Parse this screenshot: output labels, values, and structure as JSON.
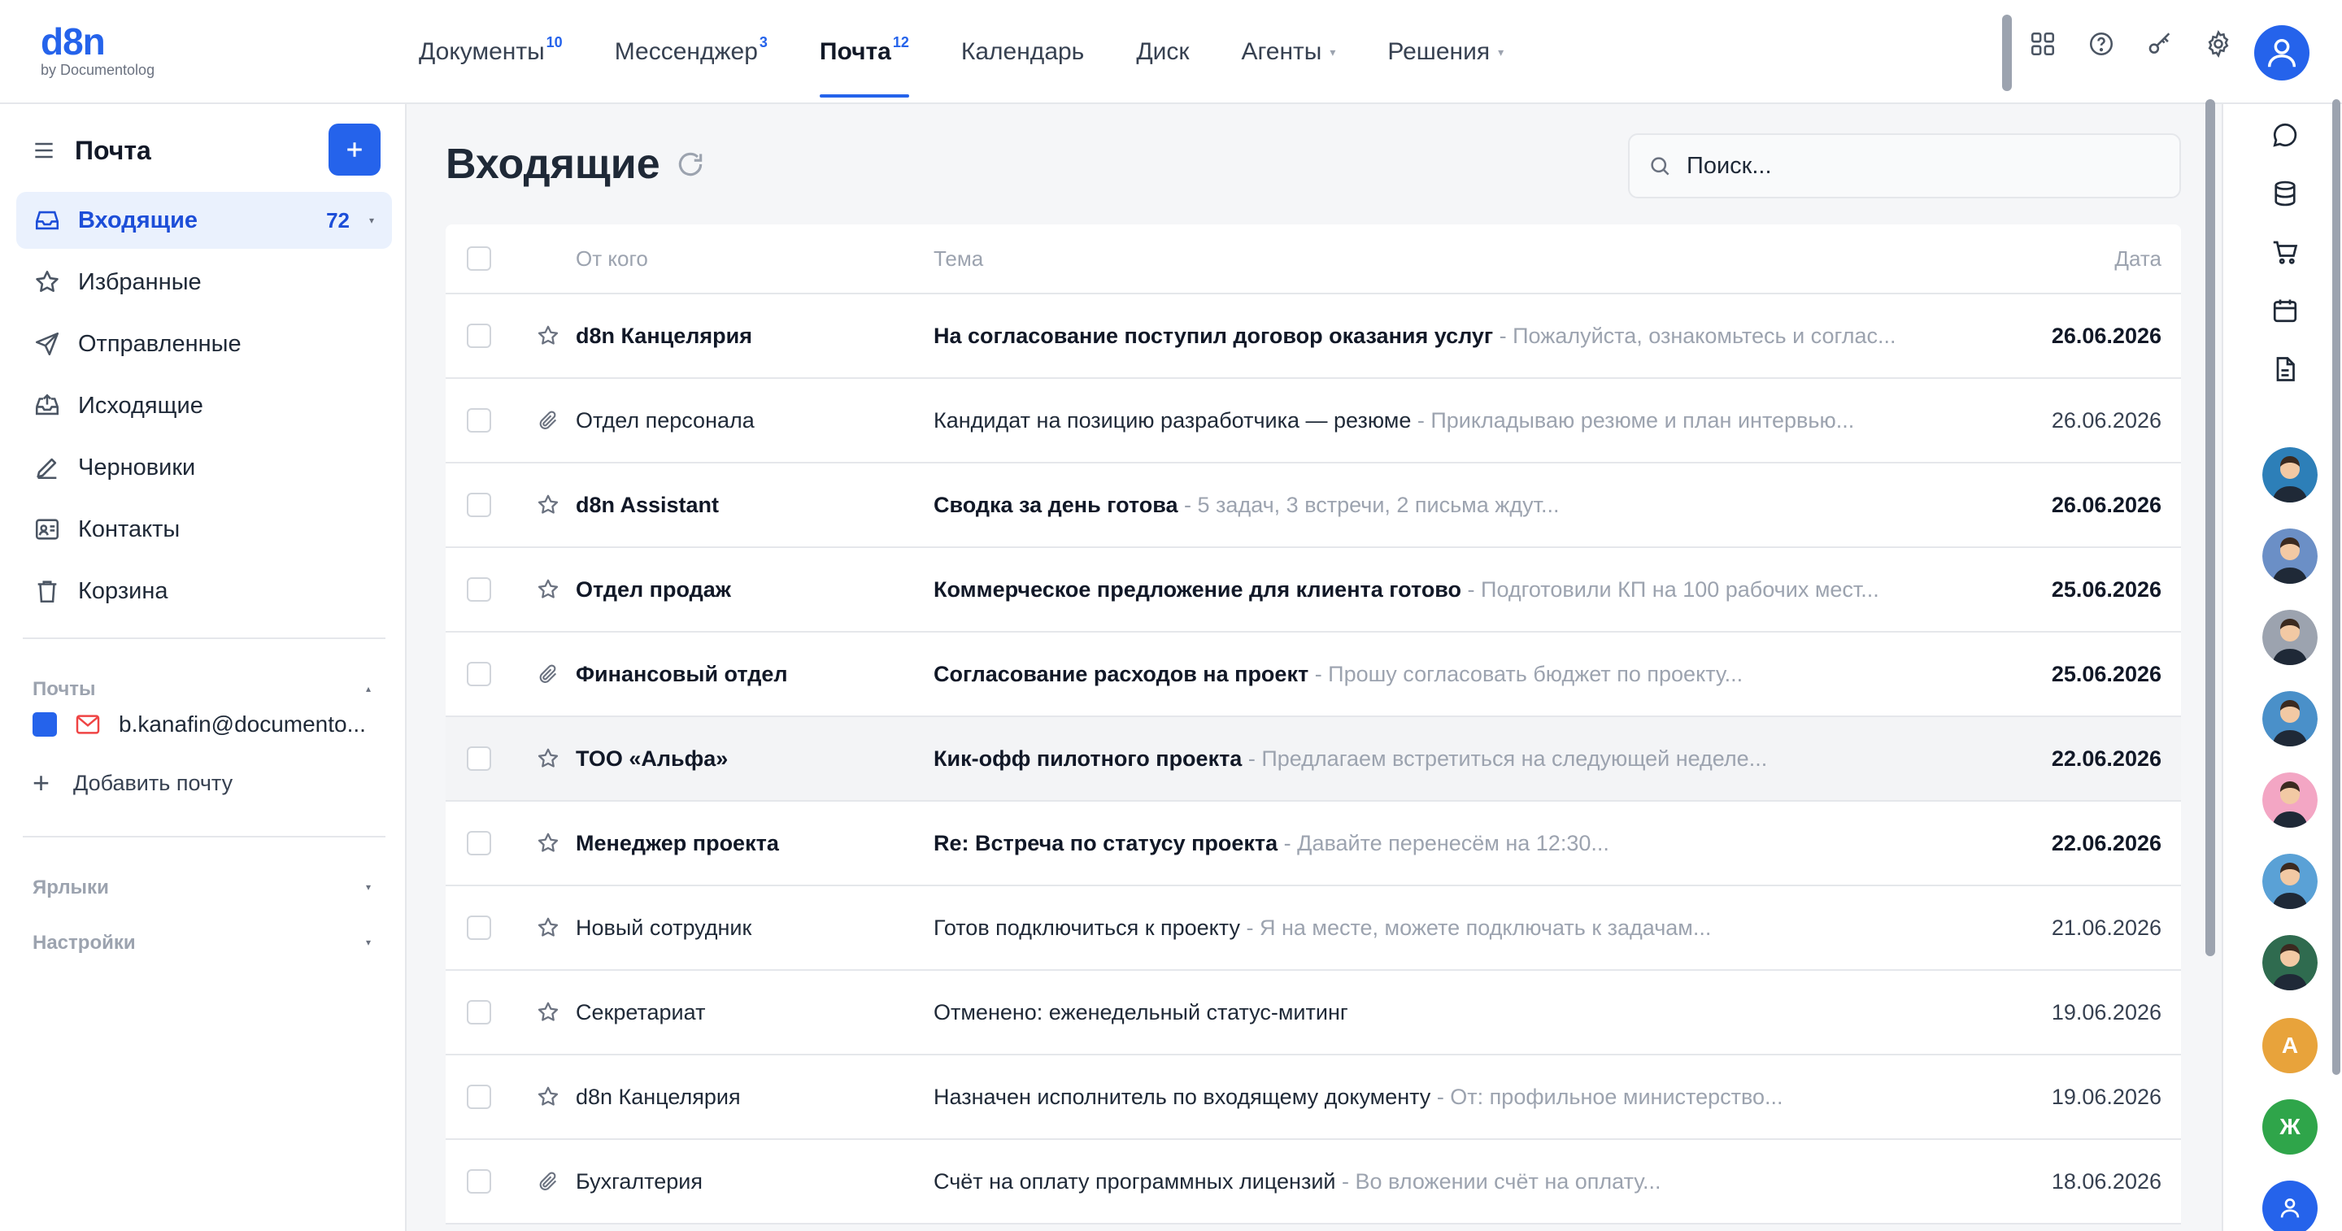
{
  "brand": {
    "name": "d8n",
    "sub": "by Documentolog",
    "color": "#2563eb"
  },
  "nav": [
    {
      "label": "Документы",
      "badge": "10",
      "active": false
    },
    {
      "label": "Мессенджер",
      "badge": "3",
      "active": false
    },
    {
      "label": "Почта",
      "badge": "12",
      "active": true
    },
    {
      "label": "Календарь",
      "badge": "",
      "active": false
    },
    {
      "label": "Диск",
      "badge": "",
      "active": false
    },
    {
      "label": "Агенты",
      "badge": "",
      "active": false,
      "dropdown": true
    },
    {
      "label": "Решения",
      "badge": "",
      "active": false,
      "dropdown": true
    }
  ],
  "top_icons": [
    "apps-grid-icon",
    "help-icon",
    "key-icon",
    "settings-gear-icon"
  ],
  "sidebar": {
    "title": "Почта",
    "compose_icon": "plus-icon",
    "folders": [
      {
        "label": "Входящие",
        "icon": "inbox-icon",
        "count": "72",
        "active": true
      },
      {
        "label": "Избранные",
        "icon": "star-icon"
      },
      {
        "label": "Отправленные",
        "icon": "send-icon"
      },
      {
        "label": "Исходящие",
        "icon": "outbox-icon"
      },
      {
        "label": "Черновики",
        "icon": "pencil-icon"
      },
      {
        "label": "Контакты",
        "icon": "contact-card-icon"
      },
      {
        "label": "Корзина",
        "icon": "trash-icon"
      }
    ],
    "mailboxes_label": "Почты",
    "mailbox": "b.kanafin@documento...",
    "add_mailbox": "Добавить почту",
    "labels_label": "Ярлыки",
    "settings_label": "Настройки"
  },
  "main": {
    "title": "Входящие",
    "search_placeholder": "Поиск...",
    "columns": {
      "from": "От кого",
      "subject": "Тема",
      "date": "Дата"
    }
  },
  "emails": [
    {
      "from": "d8n Канцелярия",
      "subject": "На согласование поступил договор оказания услуг",
      "preview": " - Пожалуйста, ознакомьтесь и соглас...",
      "date": "26.06.2026",
      "unread": true,
      "icon": "star-icon"
    },
    {
      "from": "Отдел персонала",
      "subject": "Кандидат на позицию разработчика — резюме",
      "preview": " - Прикладываю резюме и план интервью...",
      "date": "26.06.2026",
      "unread": false,
      "icon": "paperclip-icon"
    },
    {
      "from": "d8n Assistant",
      "subject": "Сводка за день готова",
      "preview": " - 5 задач, 3 встречи, 2 письма ждут...",
      "date": "26.06.2026",
      "unread": true,
      "icon": "star-icon"
    },
    {
      "from": "Отдел продаж",
      "subject": "Коммерческое предложение для клиента готово",
      "preview": " - Подготовили КП на 100 рабочих мест...",
      "date": "25.06.2026",
      "unread": true,
      "icon": "star-icon"
    },
    {
      "from": "Финансовый отдел",
      "subject": "Согласование расходов на проект",
      "preview": " - Прошу согласовать бюджет по проекту...",
      "date": "25.06.2026",
      "unread": true,
      "icon": "paperclip-icon"
    },
    {
      "from": "ТОО «Альфа»",
      "subject": "Кик-офф пилотного проекта",
      "preview": " - Предлагаем встретиться на следующей неделе...",
      "date": "22.06.2026",
      "unread": true,
      "icon": "star-icon",
      "hover": true
    },
    {
      "from": "Менеджер проекта",
      "subject": "Re: Встреча по статусу проекта",
      "preview": " - Давайте перенесём на 12:30...",
      "date": "22.06.2026",
      "unread": true,
      "icon": "star-icon"
    },
    {
      "from": "Новый сотрудник",
      "subject": "Готов подключиться к проекту",
      "preview": " - Я на месте, можете подключать к задачам...",
      "date": "21.06.2026",
      "unread": false,
      "icon": "star-icon"
    },
    {
      "from": "Секретариат",
      "subject": "Отменено: еженедельный статус-митинг",
      "preview": "",
      "date": "19.06.2026",
      "unread": false,
      "icon": "star-icon"
    },
    {
      "from": "d8n Канцелярия",
      "subject": "Назначен исполнитель по входящему документу",
      "preview": " - От: профильное министерство...",
      "date": "19.06.2026",
      "unread": false,
      "icon": "star-icon"
    },
    {
      "from": "Бухгалтерия",
      "subject": "Счёт на оплату программных лицензий",
      "preview": " - Во вложении счёт на оплату...",
      "date": "18.06.2026",
      "unread": false,
      "icon": "paperclip-icon"
    }
  ],
  "rail": {
    "icons": [
      "chat-bubble-icon",
      "database-icon",
      "cart-icon",
      "calendar-icon",
      "document-icon"
    ],
    "avatar_colors": [
      "#2d7fb8",
      "#6b8fc6",
      "#9ca3af",
      "#4a90c9",
      "#f3a6c4",
      "#5aa1d6",
      "#2f6b4f"
    ],
    "letters": [
      {
        "letter": "А",
        "color": "#e8a33b"
      },
      {
        "letter": "Ж",
        "color": "#2fa54a"
      }
    ]
  }
}
